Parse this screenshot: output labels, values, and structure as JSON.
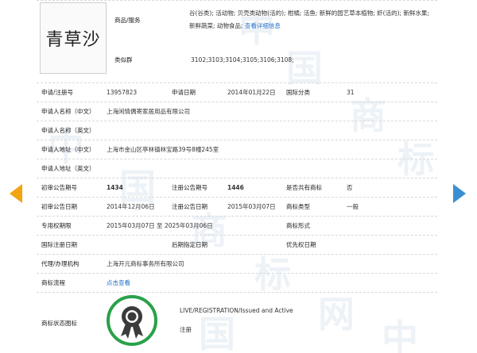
{
  "watermark": {
    "chars": [
      "中",
      "国",
      "商",
      "标",
      "网"
    ]
  },
  "trademark": {
    "logo_text": "青草沙"
  },
  "goods": {
    "label": "商品/服务",
    "text": "谷(谷类); 活动物; 贝壳类动物(活的); 柑橘; 活鱼; 新鲜的园艺草本植物; 虾(活的); 新鲜水果; 新鲜蔬菜; 动物食品;",
    "link": "查看详细信息"
  },
  "similar_group": {
    "label": "类似群",
    "value": "3102;3103;3104;3105;3106;3108;"
  },
  "fields": {
    "reg_no_label": "申请/注册号",
    "reg_no": "13957823",
    "app_date_label": "申请日期",
    "app_date": "2014年01月22日",
    "intl_class_label": "国际分类",
    "intl_class": "31",
    "applicant_cn_label": "申请人名称（中文）",
    "applicant_cn": "上海闲情偶寄家居用品有限公司",
    "applicant_en_label": "申请人名称（英文）",
    "applicant_en": "",
    "address_cn_label": "申请人地址（中文）",
    "address_cn": "上海市金山区亭林镇林宝路39号8幢245室",
    "address_en_label": "申请人地址（英文）",
    "address_en": "",
    "prelim_no_label": "初审公告期号",
    "prelim_no": "1434",
    "reg_pub_no_label": "注册公告期号",
    "reg_pub_no": "1446",
    "shared_label": "是否共有商标",
    "shared": "否",
    "prelim_date_label": "初审公告日期",
    "prelim_date": "2014年12月06日",
    "reg_pub_date_label": "注册公告日期",
    "reg_pub_date": "2015年03月07日",
    "type_label": "商标类型",
    "type": "一般",
    "exclusive_label": "专用权期限",
    "exclusive": "2015年03月07日 至 2025年03月06日",
    "form_label": "商标形式",
    "form": "",
    "intl_reg_date_label": "国际注册日期",
    "intl_reg_date": "",
    "later_date_label": "后期指定日期",
    "later_date": "",
    "priority_label": "优先权日期",
    "priority": "",
    "agent_label": "代理/办理机构",
    "agent": "上海开元商标事务所有限公司",
    "process_label": "商标流程",
    "process_link": "点击查看",
    "status_label": "商标状态图标",
    "status_en": "LIVE/REGISTRATION/Issued and Active",
    "status_cn": "注册"
  },
  "colors": {
    "arrow_left": "#f3a413",
    "arrow_right": "#3a8fd0",
    "link": "#1f6fc8",
    "badge_ring": "#2aa14a"
  },
  "icons": {
    "prev": "prev-arrow-icon",
    "next": "next-arrow-icon",
    "status": "registered-ribbon-badge-icon"
  }
}
